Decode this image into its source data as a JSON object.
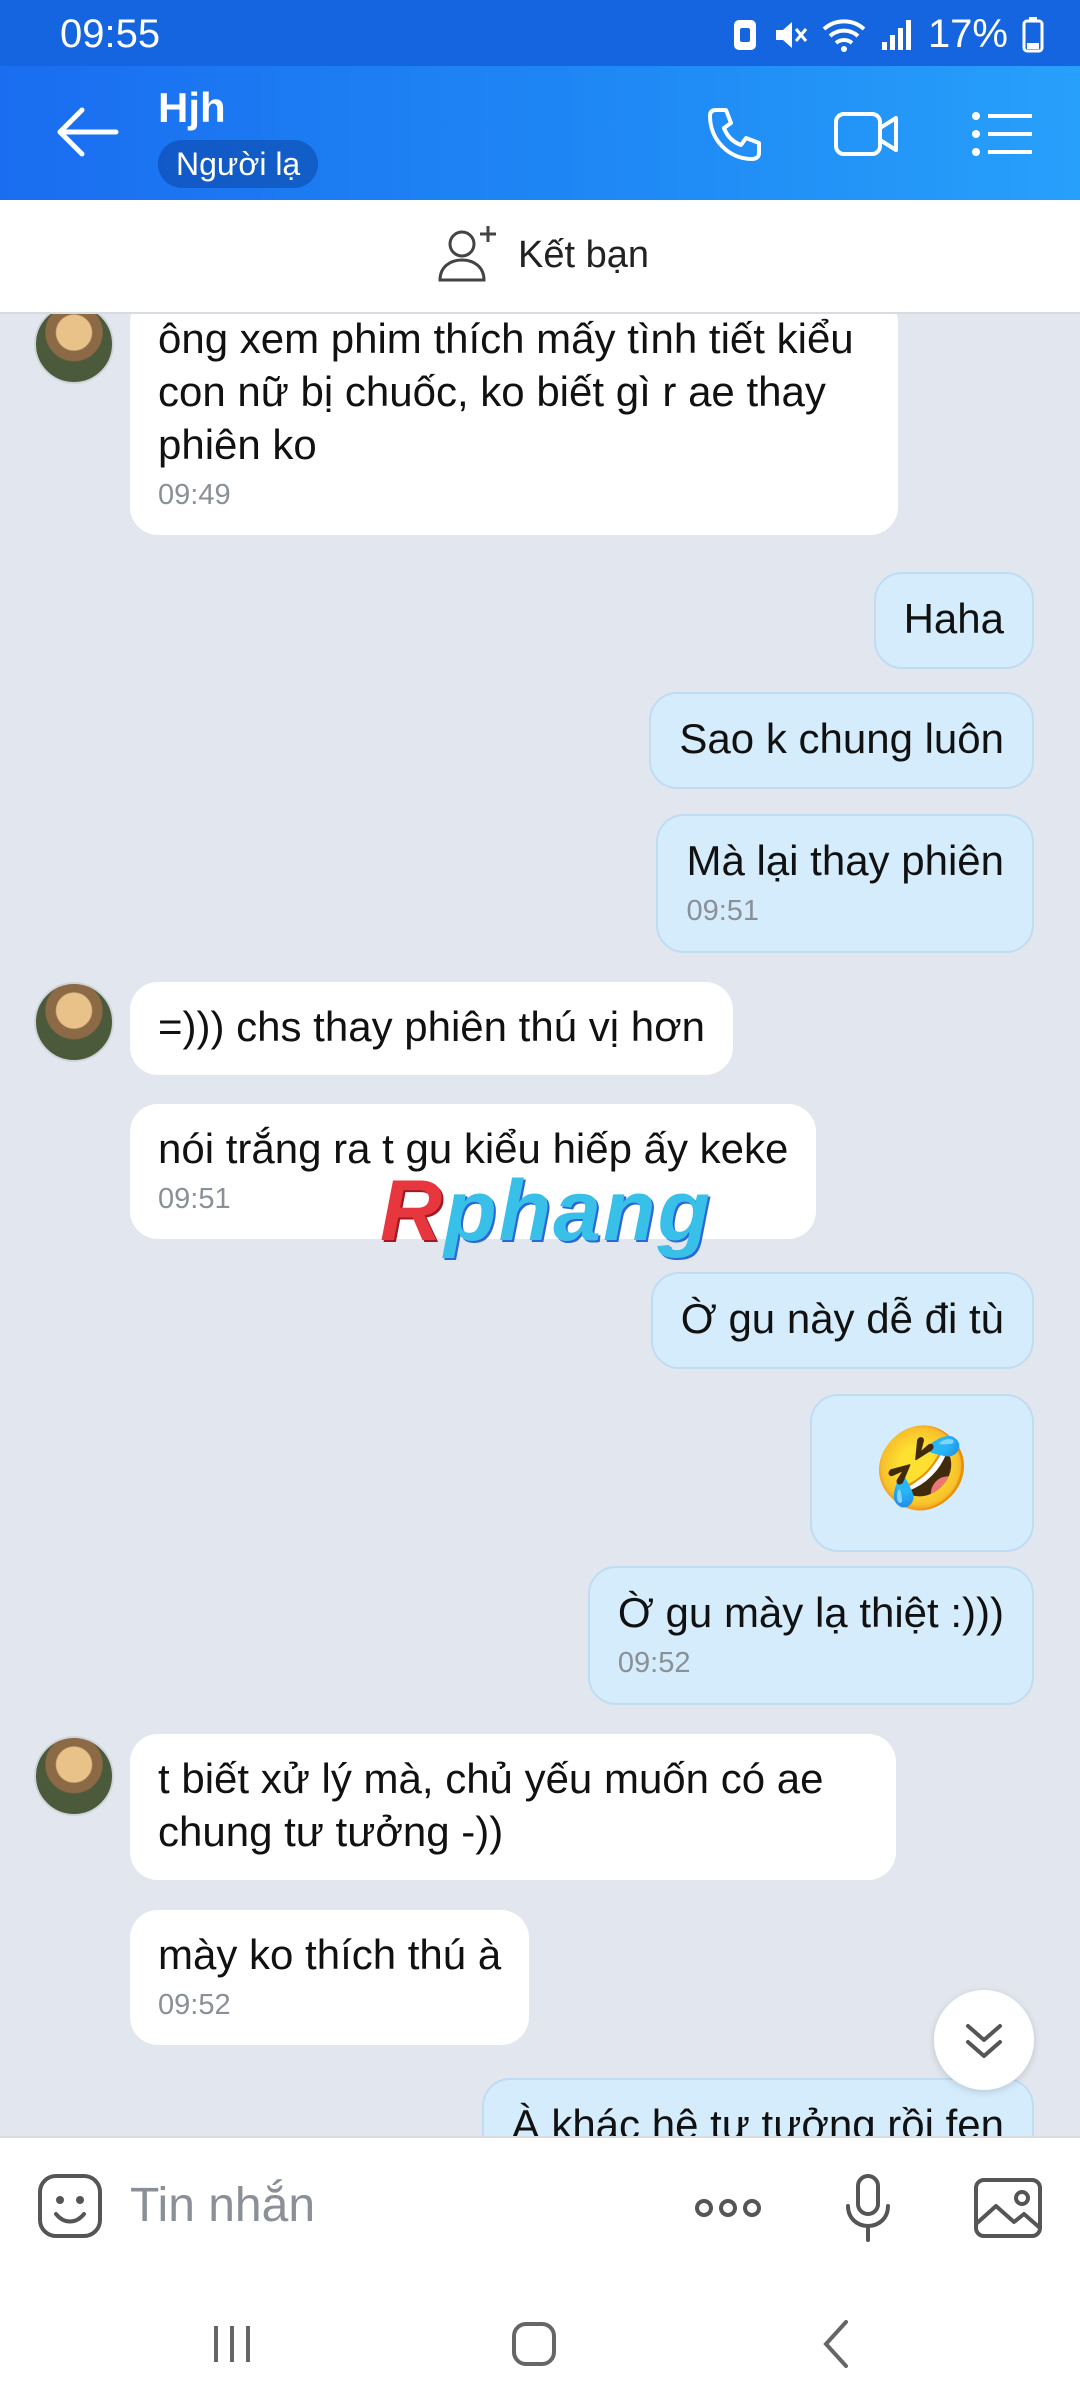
{
  "status_bar": {
    "time": "09:55",
    "battery": "17%"
  },
  "header": {
    "contact_name": "Hjh",
    "badge": "Người lạ"
  },
  "add_friend": {
    "label": "Kết bạn"
  },
  "messages": {
    "m1": {
      "text": "ông xem phim thích mấy tình tiết kiểu con nữ bị chuốc, ko biết gì r ae thay phiên ko",
      "time": "09:49"
    },
    "m2": {
      "text": "Haha"
    },
    "m3": {
      "text": "Sao k chung luôn"
    },
    "m4": {
      "text": "Mà lại thay phiên",
      "time": "09:51"
    },
    "m5": {
      "text": "=))) chs thay phiên thú vị hơn"
    },
    "m6": {
      "text": "nói trắng ra t gu kiểu hiếp ấy keke",
      "time": "09:51"
    },
    "m7": {
      "text": "Ờ gu này dễ đi tù"
    },
    "m8": {
      "emoji": "🤣"
    },
    "m9": {
      "text": "Ờ gu mày lạ thiệt :)))",
      "time": "09:52"
    },
    "m10": {
      "text": "t biết xử lý mà, chủ yếu muốn có ae chung tư tưởng -))"
    },
    "m11": {
      "text": "mày ko thích thú à",
      "time": "09:52"
    },
    "m12": {
      "text": "À khác hệ tư tưởng rồi fen"
    }
  },
  "watermark": {
    "prefix": "R",
    "rest": "phang"
  },
  "input": {
    "placeholder": "Tin nhắn"
  },
  "colors": {
    "header_blue": "#1f8af5",
    "outgoing_bubble": "#d5ecfc",
    "incoming_bubble": "#ffffff",
    "chat_bg": "#e2e7ef"
  }
}
